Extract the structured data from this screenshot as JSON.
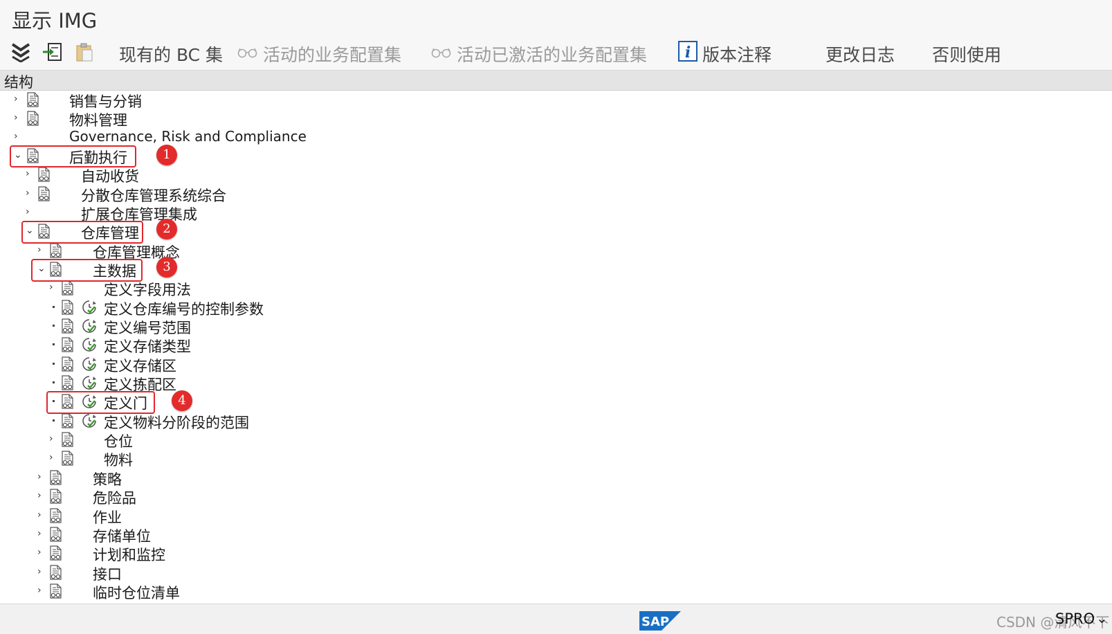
{
  "window": {
    "title": "显示 IMG"
  },
  "toolbar": {
    "existing_bc_sets": "现有的 BC 集",
    "active_bc_sets": "活动的业务配置集",
    "activated_bc_sets": "活动已激活的业务配置集",
    "release_notes": "版本注释",
    "change_log": "更改日志",
    "where_used": "否则使用"
  },
  "structure": {
    "header": "结构"
  },
  "tree": {
    "r1": "销售与分销",
    "r2": "物料管理",
    "r3": "Governance, Risk and Compliance",
    "r4": "后勤执行",
    "r5": "自动收货",
    "r6": "分散仓库管理系统综合",
    "r7": "扩展仓库管理集成",
    "r8": "仓库管理",
    "r9": "仓库管理概念",
    "r10": "主数据",
    "r11": "定义字段用法",
    "r12": "定义仓库编号的控制参数",
    "r13": "定义编号范围",
    "r14": "定义存储类型",
    "r15": "定义存储区",
    "r16": "定义拣配区",
    "r17": "定义门",
    "r18": "定义物料分阶段的范围",
    "r19": "仓位",
    "r20": "物料",
    "r21": "策略",
    "r22": "危险品",
    "r23": "作业",
    "r24": "存储单位",
    "r25": "计划和监控",
    "r26": "接口",
    "r27": "临时仓位清单"
  },
  "annotations": {
    "b1": "1",
    "b2": "2",
    "b3": "3",
    "b4": "4"
  },
  "statusbar": {
    "sap": "SAP",
    "watermark": "CSDN @清风不下",
    "tcode": "SPRO"
  },
  "colors": {
    "highlight": "#e0262b",
    "badge": "#e32b2b",
    "sap_blue": "#1a6fc4",
    "exec_green": "#3a9a2a"
  }
}
